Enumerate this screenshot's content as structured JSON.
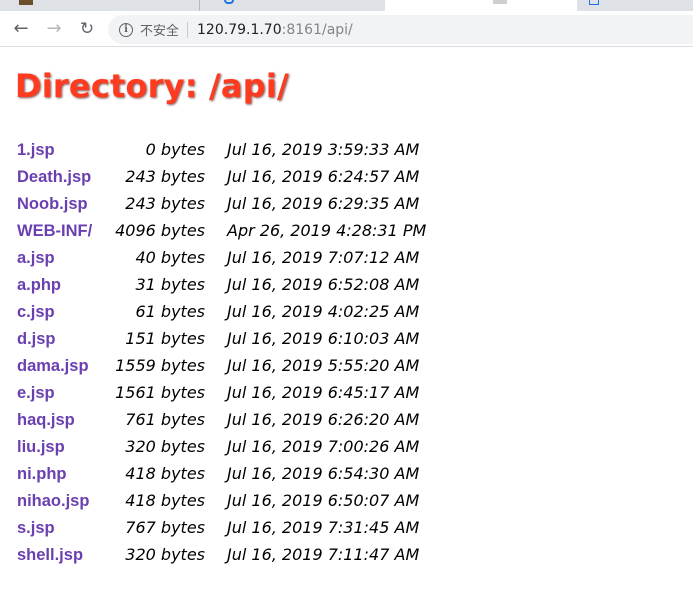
{
  "browser": {
    "address_bar": {
      "security_label": "不安全",
      "url_host": "120.79.1.70",
      "url_rest": ":8161/api/"
    }
  },
  "page": {
    "title": "Directory: /api/",
    "entries": [
      {
        "name": "1.jsp",
        "size": "0 bytes",
        "date": "Jul 16, 2019 3:59:33 AM"
      },
      {
        "name": "Death.jsp",
        "size": "243 bytes",
        "date": "Jul 16, 2019 6:24:57 AM"
      },
      {
        "name": "Noob.jsp",
        "size": "243 bytes",
        "date": "Jul 16, 2019 6:29:35 AM"
      },
      {
        "name": "WEB-INF/",
        "size": "4096 bytes",
        "date": "Apr 26, 2019 4:28:31 PM"
      },
      {
        "name": "a.jsp",
        "size": "40 bytes",
        "date": "Jul 16, 2019 7:07:12 AM"
      },
      {
        "name": "a.php",
        "size": "31 bytes",
        "date": "Jul 16, 2019 6:52:08 AM"
      },
      {
        "name": "c.jsp",
        "size": "61 bytes",
        "date": "Jul 16, 2019 4:02:25 AM"
      },
      {
        "name": "d.jsp",
        "size": "151 bytes",
        "date": "Jul 16, 2019 6:10:03 AM"
      },
      {
        "name": "dama.jsp",
        "size": "1559 bytes",
        "date": "Jul 16, 2019 5:55:20 AM"
      },
      {
        "name": "e.jsp",
        "size": "1561 bytes",
        "date": "Jul 16, 2019 6:45:17 AM"
      },
      {
        "name": "haq.jsp",
        "size": "761 bytes",
        "date": "Jul 16, 2019 6:26:20 AM"
      },
      {
        "name": "liu.jsp",
        "size": "320 bytes",
        "date": "Jul 16, 2019 7:00:26 AM"
      },
      {
        "name": "ni.php",
        "size": "418 bytes",
        "date": "Jul 16, 2019 6:54:30 AM"
      },
      {
        "name": "nihao.jsp",
        "size": "418 bytes",
        "date": "Jul 16, 2019 6:50:07 AM"
      },
      {
        "name": "s.jsp",
        "size": "767 bytes",
        "date": "Jul 16, 2019 7:31:45 AM"
      },
      {
        "name": "shell.jsp",
        "size": "320 bytes",
        "date": "Jul 16, 2019 7:11:47 AM"
      }
    ]
  }
}
